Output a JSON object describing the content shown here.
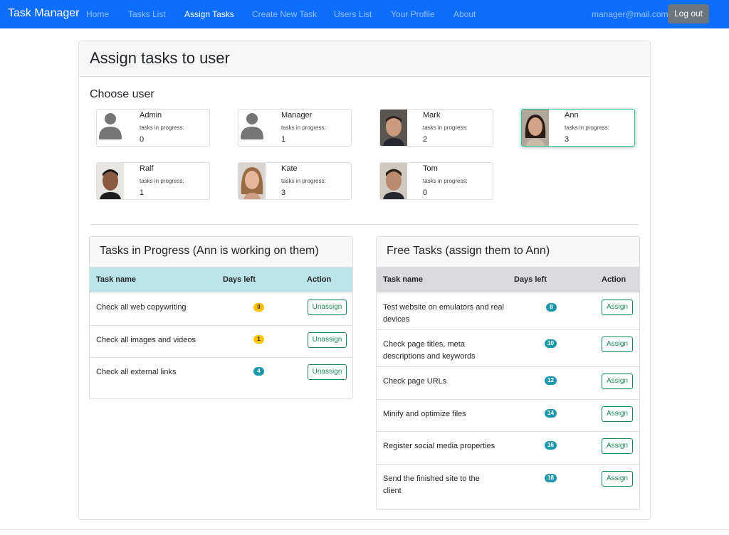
{
  "navbar": {
    "brand": "Task Manager",
    "links": [
      {
        "label": "Home",
        "active": false
      },
      {
        "label": "Tasks List",
        "active": false
      },
      {
        "label": "Assign Tasks",
        "active": true
      },
      {
        "label": "Create New Task",
        "active": false
      },
      {
        "label": "Users List",
        "active": false
      },
      {
        "label": "Your Profile",
        "active": false
      },
      {
        "label": "About",
        "active": false
      }
    ],
    "email": "manager@mail.com",
    "logout_label": "Log out"
  },
  "colors": {
    "brand_blue": "#0d6efd",
    "in_progress_header": "#bde4ea",
    "free_header": "#d9d9de",
    "badge_warning": "#ffc107",
    "badge_info": "#1f97ab",
    "assign_green": "#198754",
    "selected_border": "#20c997"
  },
  "page": {
    "title": "Assign tasks to user",
    "choose_user_label": "Choose user"
  },
  "users": [
    {
      "name": "Admin",
      "progress_label": "tasks in progress:",
      "count": "0",
      "avatar": "default-person-icon",
      "selected": false
    },
    {
      "name": "Manager",
      "progress_label": "tasks in progress:",
      "count": "1",
      "avatar": "default-person-icon",
      "selected": false
    },
    {
      "name": "Mark",
      "progress_label": "tasks in progress:",
      "count": "2",
      "avatar": "photo",
      "selected": false
    },
    {
      "name": "Ann",
      "progress_label": "tasks in progress:",
      "count": "3",
      "avatar": "photo",
      "selected": true
    },
    {
      "name": "Ralf",
      "progress_label": "tasks in progress:",
      "count": "1",
      "avatar": "photo",
      "selected": false
    },
    {
      "name": "Kate",
      "progress_label": "tasks in progress:",
      "count": "3",
      "avatar": "photo",
      "selected": false
    },
    {
      "name": "Tom",
      "progress_label": "tasks in progress:",
      "count": "0",
      "avatar": "photo",
      "selected": false
    }
  ],
  "in_progress": {
    "title": "Tasks in Progress (Ann is working on them)",
    "columns": [
      "Task name",
      "Days left",
      "Action"
    ],
    "rows": [
      {
        "task": "Check all web copywriting",
        "days": "0",
        "badge_style": "warning",
        "action": "Unassign"
      },
      {
        "task": "Check all images and videos",
        "days": "1",
        "badge_style": "warning",
        "action": "Unassign"
      },
      {
        "task": "Check all external links",
        "days": "4",
        "badge_style": "info",
        "action": "Unassign"
      }
    ]
  },
  "free_tasks": {
    "title": "Free Tasks (assign them to Ann)",
    "columns": [
      "Task name",
      "Days left",
      "Action"
    ],
    "rows": [
      {
        "task": "Test website on emulators and real devices",
        "days": "8",
        "badge_style": "info",
        "action": "Assign"
      },
      {
        "task": "Check page titles, meta descriptions and keywords",
        "days": "10",
        "badge_style": "info",
        "action": "Assign"
      },
      {
        "task": "Check page URLs",
        "days": "12",
        "badge_style": "info",
        "action": "Assign"
      },
      {
        "task": "Minify and optimize files",
        "days": "14",
        "badge_style": "info",
        "action": "Assign"
      },
      {
        "task": "Register social media properties",
        "days": "16",
        "badge_style": "info",
        "action": "Assign"
      },
      {
        "task": "Send the finished site to the client",
        "days": "18",
        "badge_style": "info",
        "action": "Assign"
      }
    ]
  }
}
